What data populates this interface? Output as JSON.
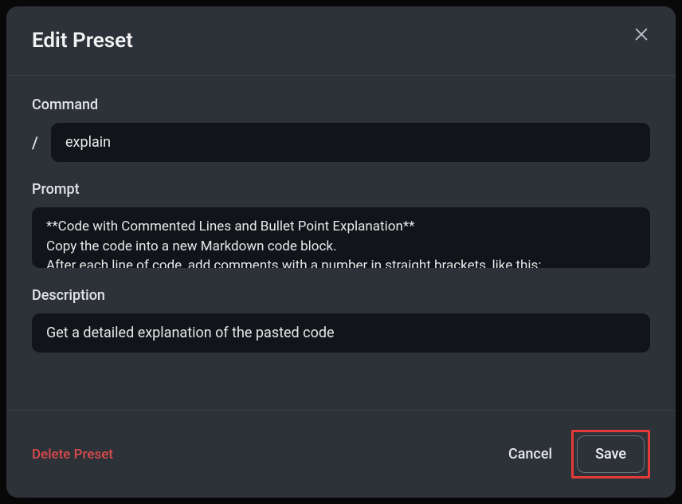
{
  "modal": {
    "title": "Edit Preset",
    "labels": {
      "command": "Command",
      "prompt": "Prompt",
      "description": "Description"
    },
    "command": {
      "prefix": "/",
      "value": "explain"
    },
    "prompt": {
      "value": "**Code with Commented Lines and Bullet Point Explanation**\nCopy the code into a new Markdown code block.\nAfter each line of code, add comments with a number in straight brackets, like this:"
    },
    "description": {
      "value": "Get a detailed explanation of the pasted code"
    },
    "buttons": {
      "delete": "Delete Preset",
      "cancel": "Cancel",
      "save": "Save"
    }
  }
}
